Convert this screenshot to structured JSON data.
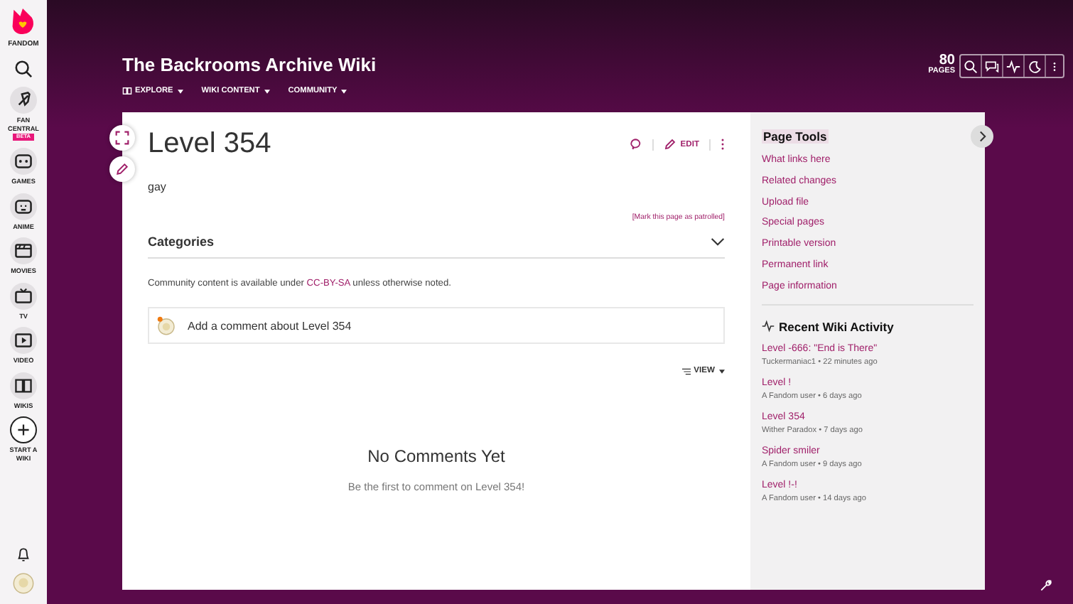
{
  "rail": {
    "logo": "FANDOM",
    "items": [
      {
        "label": "FAN CENTRAL",
        "badge": "BETA"
      },
      {
        "label": "GAMES"
      },
      {
        "label": "ANIME"
      },
      {
        "label": "MOVIES"
      },
      {
        "label": "TV"
      },
      {
        "label": "VIDEO"
      },
      {
        "label": "WIKIS"
      },
      {
        "label": "START A WIKI"
      }
    ]
  },
  "header": {
    "title": "The Backrooms Archive Wiki",
    "nav": [
      "EXPLORE",
      "WIKI CONTENT",
      "COMMUNITY"
    ],
    "page_count": "80",
    "page_count_label": "PAGES"
  },
  "article": {
    "title": "Level 354",
    "edit": "EDIT",
    "body": "gay",
    "patrol": "[Mark this page as patrolled]",
    "categories": "Categories",
    "license_before": "Community content is available under",
    "license_link": "CC-BY-SA",
    "license_after": "unless otherwise noted."
  },
  "comments": {
    "placeholder": "Add a comment about Level 354",
    "view": "VIEW",
    "empty_title": "No Comments Yet",
    "empty_text": "Be the first to comment on Level 354!"
  },
  "page_tools": {
    "title": "Page Tools",
    "links": [
      "What links here",
      "Related changes",
      "Upload file",
      "Special pages",
      "Printable version",
      "Permanent link",
      "Page information"
    ]
  },
  "recent_activity": {
    "title": "Recent Wiki Activity",
    "items": [
      {
        "title": "Level -666: \"End is There\"",
        "meta": "Tuckermaniac1 • 22 minutes ago"
      },
      {
        "title": "Level !",
        "meta": "A Fandom user • 6 days ago"
      },
      {
        "title": "Level 354",
        "meta": "Wither Paradox • 7 days ago"
      },
      {
        "title": "Spider smiler",
        "meta": "A Fandom user • 9 days ago"
      },
      {
        "title": "Level !-!",
        "meta": "A Fandom user • 14 days ago"
      }
    ]
  }
}
